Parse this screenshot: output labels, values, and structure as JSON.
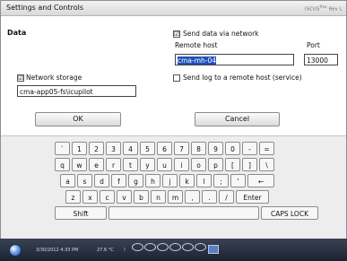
{
  "window": {
    "title": "Settings and Controls",
    "brand": "ISCUS",
    "brand_sup": "flex",
    "brand_suffix": "Rev L"
  },
  "data_section": {
    "title": "Data",
    "send_via_network": {
      "label": "Send data via network",
      "checked": true,
      "mark": "☑"
    },
    "remote_host": {
      "label": "Remote host",
      "value": "cma-mh-04"
    },
    "port": {
      "label": "Port",
      "value": "13000"
    },
    "network_storage": {
      "label": "Network storage",
      "checked": true,
      "mark": "☑",
      "value": "cma-app05-fs\\icupilot"
    },
    "send_log": {
      "label": "Send log to a remote host (service)",
      "checked": false,
      "mark": ""
    }
  },
  "buttons": {
    "ok": "OK",
    "cancel": "Cancel"
  },
  "keyboard": {
    "row1": [
      "`",
      "1",
      "2",
      "3",
      "4",
      "5",
      "6",
      "7",
      "8",
      "9",
      "0",
      "-",
      "="
    ],
    "row2": [
      "q",
      "w",
      "e",
      "r",
      "t",
      "y",
      "u",
      "i",
      "o",
      "p",
      "[",
      "]",
      "\\"
    ],
    "row3": [
      "a",
      "s",
      "d",
      "f",
      "g",
      "h",
      "j",
      "k",
      "l",
      ";",
      "'",
      "←"
    ],
    "row4": [
      "z",
      "x",
      "c",
      "v",
      "b",
      "n",
      "m",
      ",",
      ".",
      "/",
      "Enter"
    ],
    "shift": "Shift",
    "space": "",
    "caps": "CAPS LOCK"
  },
  "taskbar": {
    "datetime": "3/30/2012 4:33 PM",
    "temperature": "27.6 °C",
    "separator": "!"
  },
  "colors": {
    "selection": "#1f4fb8",
    "taskbar": "#2a3140"
  },
  "icons": [
    "start-orb-icon",
    "tray-status-icon"
  ]
}
